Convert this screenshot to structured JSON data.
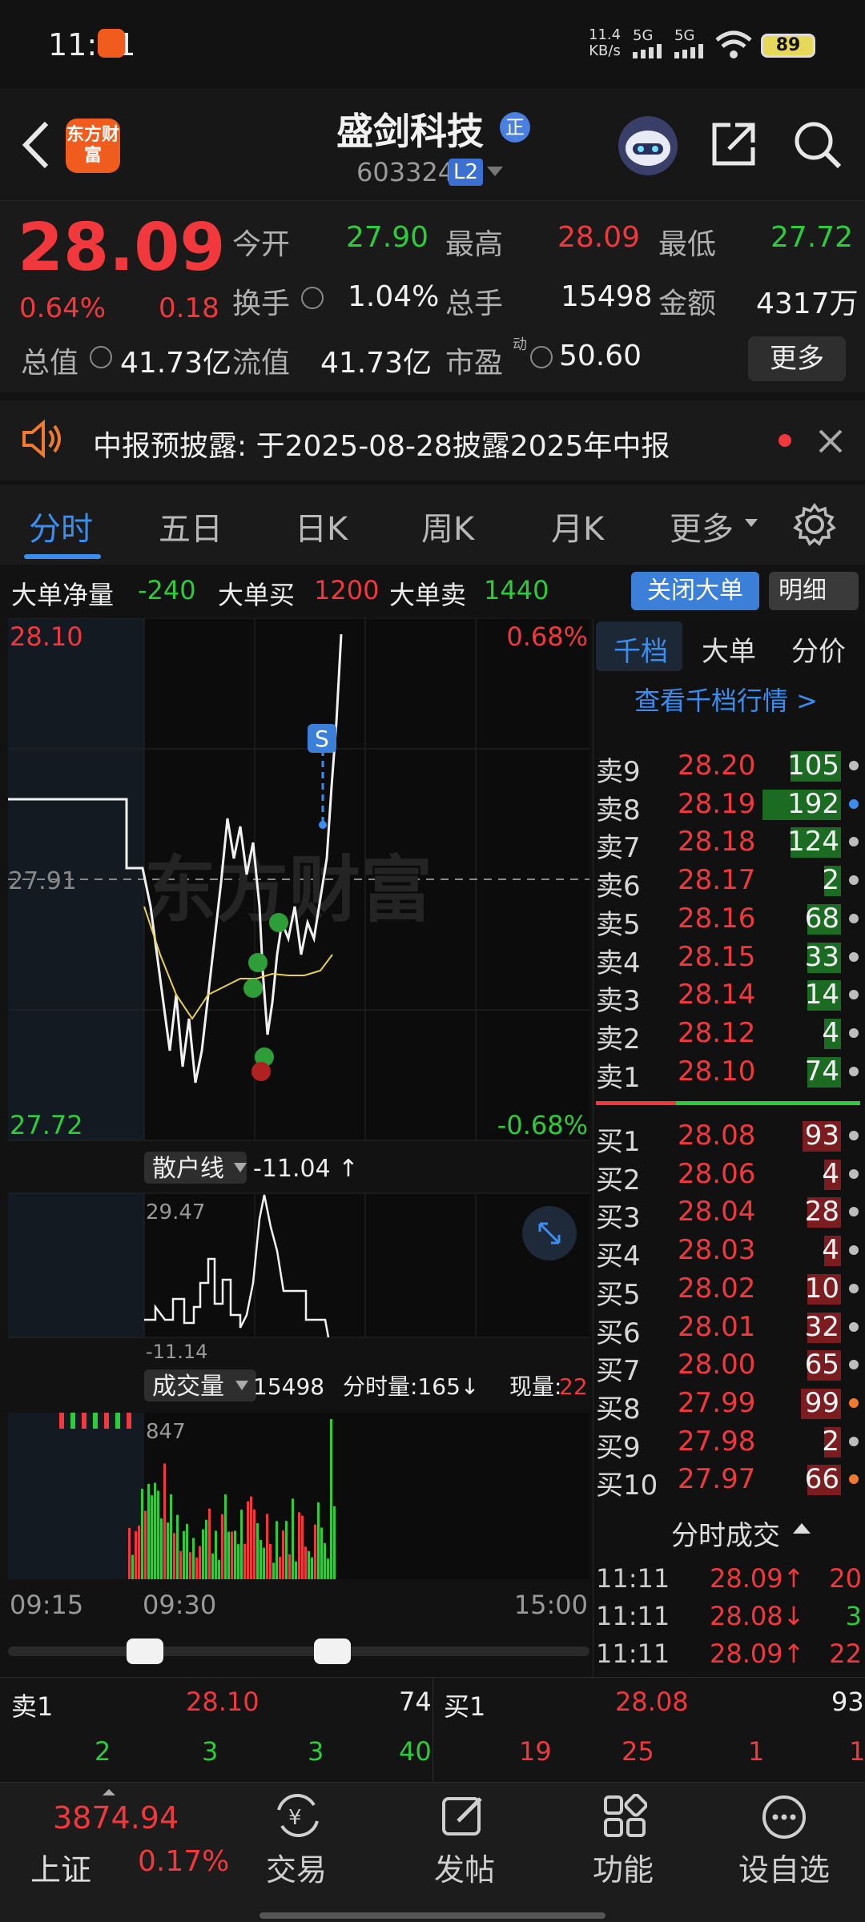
{
  "status": {
    "time": "11:11",
    "net_speed_top": "11.4",
    "net_speed_bottom": "KB/s",
    "signal1": "5G",
    "signal2": "5G",
    "battery": "89"
  },
  "header": {
    "logo_text": "东方财富",
    "stock_name": "盛剑科技",
    "badge": "正",
    "stock_code": "603324",
    "level": "L2"
  },
  "quote": {
    "price": "28.09",
    "change_pct": "0.64%",
    "change": "0.18",
    "open_label": "今开",
    "open": "27.90",
    "high_label": "最高",
    "high": "28.09",
    "low_label": "最低",
    "low": "27.72",
    "turnover_label": "换手",
    "turnover": "1.04%",
    "volume_label": "总手",
    "volume": "15498",
    "amount_label": "金额",
    "amount": "4317万",
    "mktcap_label": "总值",
    "mktcap": "41.73亿",
    "float_label": "流值",
    "float_cap": "41.73亿",
    "pe_label": "市盈",
    "pe_sup": "动",
    "pe": "50.60",
    "more_button": "更多"
  },
  "notice": {
    "text": "中报预披露:  于2025-08-28披露2025年中报"
  },
  "tabs": [
    "分时",
    "五日",
    "日K",
    "周K",
    "月K",
    "更多"
  ],
  "big_order": {
    "net_label": "大单净量",
    "net": "-240",
    "buy_label": "大单买",
    "buy": "1200",
    "sell_label": "大单卖",
    "sell": "1440",
    "close_button": "关闭大单",
    "detail_button": "明细"
  },
  "chart": {
    "price_high": "28.10",
    "price_low": "27.72",
    "pct_high": "0.68%",
    "pct_low": "-0.68%",
    "prev_close": "27.91",
    "watermark": "东方财富",
    "retail_label": "散户线",
    "retail_value": "-11.04 ↑",
    "retail_max": "29.47",
    "retail_min": "-11.14",
    "volume_label": "成交量",
    "volume_value": "15498",
    "minute_volume": "分时量:165↓",
    "current_volume_label": "现量:",
    "current_volume": "22",
    "vol_max": "847",
    "time_start": "09:15",
    "time_open": "09:30",
    "time_end": "15:00"
  },
  "orderbook": {
    "tabs": [
      "千档",
      "大单",
      "分价"
    ],
    "link": "查看千档行情 >",
    "asks": [
      {
        "label": "卖9",
        "price": "28.20",
        "qty": "105",
        "bar": 0.22
      },
      {
        "label": "卖8",
        "price": "28.19",
        "qty": "192",
        "bar": 0.41
      },
      {
        "label": "卖7",
        "price": "28.18",
        "qty": "124",
        "bar": 0.26
      },
      {
        "label": "卖6",
        "price": "28.17",
        "qty": "2",
        "bar": 0
      },
      {
        "label": "卖5",
        "price": "28.16",
        "qty": "68",
        "bar": 0.14
      },
      {
        "label": "卖4",
        "price": "28.15",
        "qty": "33",
        "bar": 0.07
      },
      {
        "label": "卖3",
        "price": "28.14",
        "qty": "14",
        "bar": 0.03
      },
      {
        "label": "卖2",
        "price": "28.12",
        "qty": "4",
        "bar": 0
      },
      {
        "label": "卖1",
        "price": "28.10",
        "qty": "74",
        "bar": 0.15
      }
    ],
    "bids": [
      {
        "label": "买1",
        "price": "28.08",
        "qty": "93",
        "bar": 0.2
      },
      {
        "label": "买2",
        "price": "28.06",
        "qty": "4",
        "bar": 0
      },
      {
        "label": "买3",
        "price": "28.04",
        "qty": "28",
        "bar": 0.05
      },
      {
        "label": "买4",
        "price": "28.03",
        "qty": "4",
        "bar": 0
      },
      {
        "label": "买5",
        "price": "28.02",
        "qty": "10",
        "bar": 0.02
      },
      {
        "label": "买6",
        "price": "28.01",
        "qty": "32",
        "bar": 0.06
      },
      {
        "label": "买7",
        "price": "28.00",
        "qty": "65",
        "bar": 0.14
      },
      {
        "label": "买8",
        "price": "27.99",
        "qty": "99",
        "bar": 0.21
      },
      {
        "label": "买9",
        "price": "27.98",
        "qty": "2",
        "bar": 0
      },
      {
        "label": "买10",
        "price": "27.97",
        "qty": "66",
        "bar": 0.14
      }
    ]
  },
  "trades": {
    "title": "分时成交",
    "rows": [
      {
        "time": "11:11",
        "price": "28.09↑",
        "qty": "20"
      },
      {
        "time": "11:11",
        "price": "28.08↓",
        "qty": "3"
      },
      {
        "time": "11:11",
        "price": "28.09↑",
        "qty": "22"
      }
    ]
  },
  "bottom_quote": {
    "sell_label": "卖1",
    "sell_price": "28.10",
    "sell_qty": "74",
    "buy_label": "买1",
    "buy_price": "28.08",
    "buy_qty": "93",
    "sell_queue": [
      "2",
      "3",
      "3",
      "40"
    ],
    "buy_queue": [
      "19",
      "25",
      "1",
      "1"
    ]
  },
  "nav": {
    "index_value": "3874.94",
    "index_name": "上证",
    "index_change": "0.17%",
    "items": [
      "交易",
      "发帖",
      "功能",
      "设自选"
    ]
  }
}
